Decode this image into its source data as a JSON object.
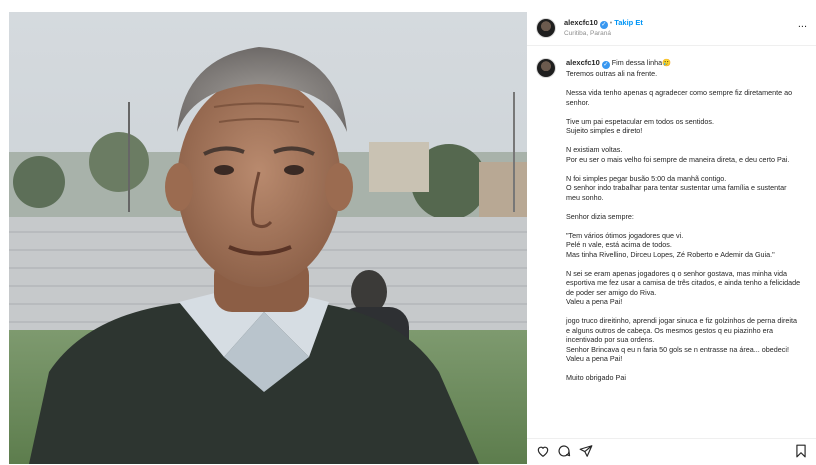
{
  "post": {
    "author": "alexcfc10",
    "follow_label": "Takip Et",
    "separator": "•",
    "location": "Curitiba, Paraná",
    "more_label": "..."
  },
  "caption": {
    "first_line": "Fim dessa linha",
    "emoji": "🥲",
    "paragraphs": [
      "Teremos outras ali na frente.",
      "Nessa vida tenho apenas q agradecer como sempre fiz diretamente ao senhor.",
      "Tive um pai espetacular em todos os sentidos.\nSujeito simples e direto!",
      "N existiam voltas.\nPor eu ser o mais velho foi sempre de maneira direta, e deu certo Pai.",
      "N foi simples pegar busão 5:00 da manhã contigo.\nO senhor indo trabalhar para tentar sustentar uma família e sustentar meu sonho.",
      "Senhor dizia sempre:",
      "\"Tem vários ótimos jogadores que vi.\nPelé n vale, está acima de todos.\nMas tinha Rivellino, Dirceu Lopes, Zé Roberto e Ademir da Guia.\"",
      "N sei se eram apenas jogadores q o senhor gostava, mas minha vida esportiva me fez usar a camisa de três citados, e ainda tenho a felicidade de poder ser amigo do Riva.\nValeu a pena Pai!",
      "jogo truco direitinho, aprendi jogar sinuca e fiz golzinhos de perna direita e alguns outros de cabeça. Os mesmos gestos q eu piazinho era incentivado por sua ordens.\nSenhor Brincava q eu n faria 50 gols se n entrasse na área... obedeci!\nValeu a pena Pai!",
      "Muito obrigado Pai"
    ]
  },
  "icons": {
    "like": "heart-icon",
    "comment": "comment-icon",
    "share": "share-icon",
    "save": "bookmark-icon",
    "verified": "verified-badge-icon",
    "avatar": "avatar"
  },
  "colors": {
    "link": "#0095f6",
    "verified": "#3897f0",
    "muted": "#8e8e8e",
    "text": "#262626"
  }
}
